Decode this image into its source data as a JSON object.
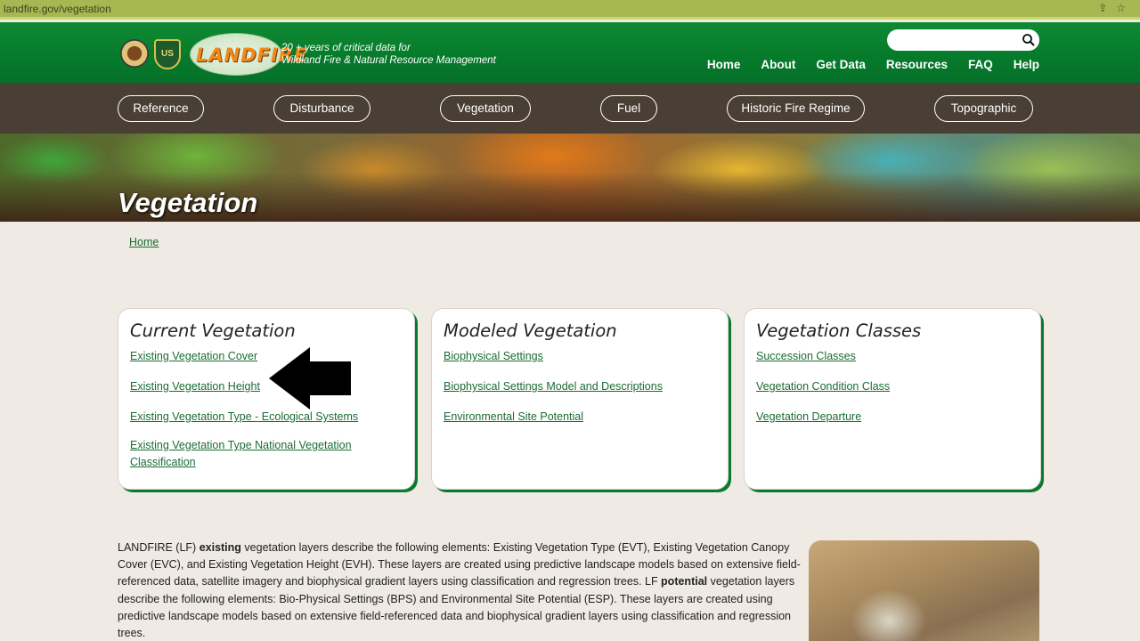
{
  "browser": {
    "url": "landfire.gov/vegetation"
  },
  "header": {
    "logo_text": "LANDFIRE",
    "usfs_text": "US",
    "tagline_line1": "20 + years of critical data for",
    "tagline_line2": "Wildland Fire & Natural Resource Management",
    "search_placeholder": "",
    "nav": [
      "Home",
      "About",
      "Get Data",
      "Resources",
      "FAQ",
      "Help"
    ]
  },
  "categories": [
    "Reference",
    "Disturbance",
    "Vegetation",
    "Fuel",
    "Historic Fire Regime",
    "Topographic"
  ],
  "hero": {
    "title": "Vegetation"
  },
  "breadcrumb": "Home",
  "cards": [
    {
      "title": "Current Vegetation",
      "links": [
        "Existing Vegetation Cover",
        "Existing Vegetation Height",
        "Existing Vegetation Type - Ecological Systems",
        "Existing Vegetation Type National Vegetation Classification"
      ]
    },
    {
      "title": "Modeled Vegetation",
      "links": [
        "Biophysical Settings",
        "Biophysical Settings Model and Descriptions",
        "Environmental Site Potential"
      ]
    },
    {
      "title": "Vegetation Classes",
      "links": [
        "Succession Classes",
        "Vegetation Condition Class",
        "Vegetation Departure"
      ]
    }
  ],
  "body": {
    "p1_a": "LANDFIRE (LF) ",
    "p1_b": "existing",
    "p1_c": " vegetation layers describe the following elements: Existing Vegetation Type (EVT), Existing Vegetation Canopy Cover (EVC), and Existing Vegetation Height (EVH). These layers are created using predictive landscape models based on extensive field-referenced data, satellite imagery and biophysical gradient layers using classification and regression trees. LF ",
    "p1_d": "potential",
    "p1_e": " vegetation layers describe the following elements: Bio-Physical Settings (BPS) and Environmental Site Potential (ESP). These layers are created using predictive landscape models based on extensive field-referenced data and biophysical gradient layers using classification and regression trees."
  },
  "colors": {
    "brand_green": "#0b7a31",
    "catbar": "#4a3f35",
    "link": "#1a6b34"
  }
}
